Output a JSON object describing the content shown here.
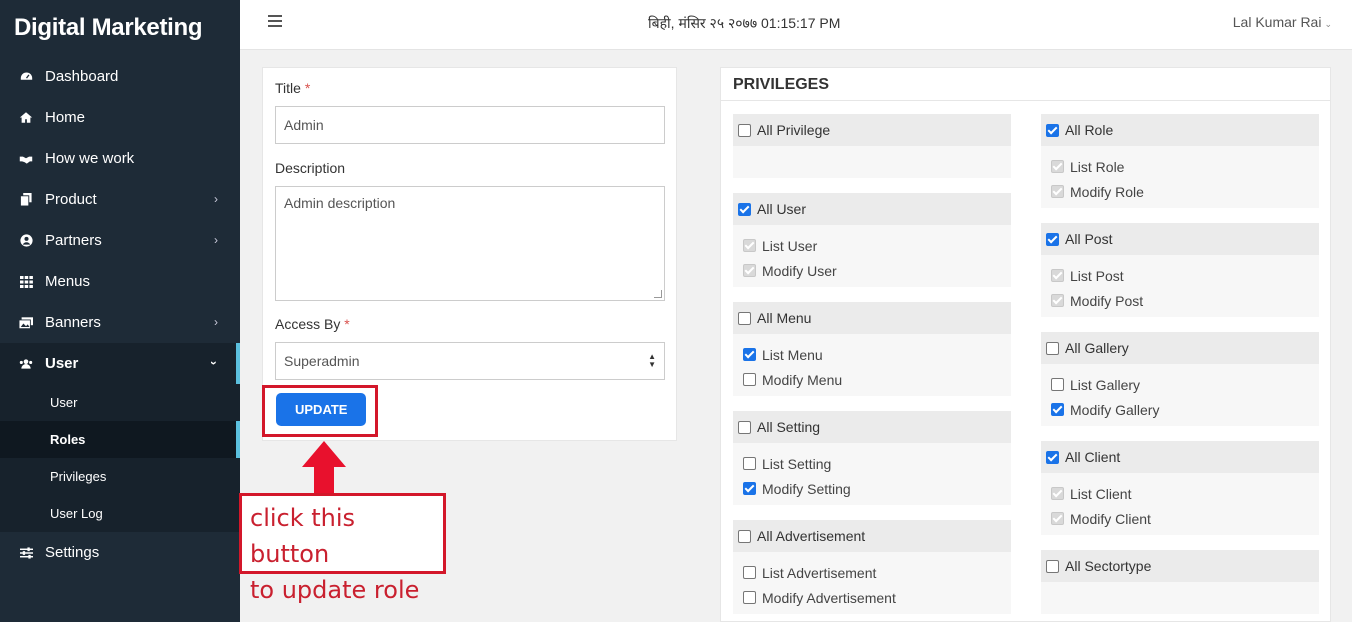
{
  "sidebar": {
    "brand": "Digital Marketing",
    "items": [
      {
        "label": "Dashboard",
        "icon": "dashboard-icon"
      },
      {
        "label": "Home",
        "icon": "home-icon"
      },
      {
        "label": "How we work",
        "icon": "handshake-icon"
      },
      {
        "label": "Product",
        "icon": "product-icon"
      },
      {
        "label": "Partners",
        "icon": "partners-icon"
      },
      {
        "label": "Menus",
        "icon": "grid-icon"
      },
      {
        "label": "Banners",
        "icon": "banners-icon"
      },
      {
        "label": "User",
        "icon": "users-icon"
      },
      {
        "label": "Settings",
        "icon": "sliders-icon"
      }
    ],
    "user_sub": [
      "User",
      "Roles",
      "Privileges",
      "User Log"
    ]
  },
  "header": {
    "datetime": "बिही, मंसिर २५ २०७७ 01:15:17 PM",
    "user": "Lal Kumar Rai"
  },
  "form": {
    "title_label": "Title",
    "title_value": "Admin",
    "description_label": "Description",
    "description_value": "Admin description",
    "access_label": "Access By",
    "access_value": "Superadmin",
    "required_mark": "*",
    "update_label": "UPDATE"
  },
  "annotation": {
    "line1": "click this button",
    "line2": "to update role"
  },
  "privileges": {
    "title": "PRIVILEGES",
    "left": [
      {
        "head": "All Privilege",
        "checked": false,
        "items": []
      },
      {
        "head": "All User",
        "checked": true,
        "items": [
          {
            "label": "List User",
            "state": "disabled"
          },
          {
            "label": "Modify User",
            "state": "disabled"
          }
        ]
      },
      {
        "head": "All Menu",
        "checked": false,
        "items": [
          {
            "label": "List Menu",
            "state": "checked"
          },
          {
            "label": "Modify Menu",
            "state": "unchecked"
          }
        ]
      },
      {
        "head": "All Setting",
        "checked": false,
        "items": [
          {
            "label": "List Setting",
            "state": "unchecked"
          },
          {
            "label": "Modify Setting",
            "state": "checked"
          }
        ]
      },
      {
        "head": "All Advertisement",
        "checked": false,
        "items": [
          {
            "label": "List Advertisement",
            "state": "unchecked"
          },
          {
            "label": "Modify Advertisement",
            "state": "unchecked"
          }
        ]
      }
    ],
    "right": [
      {
        "head": "All Role",
        "checked": true,
        "items": [
          {
            "label": "List Role",
            "state": "disabled"
          },
          {
            "label": "Modify Role",
            "state": "disabled"
          }
        ]
      },
      {
        "head": "All Post",
        "checked": true,
        "items": [
          {
            "label": "List Post",
            "state": "disabled"
          },
          {
            "label": "Modify Post",
            "state": "disabled"
          }
        ]
      },
      {
        "head": "All Gallery",
        "checked": false,
        "items": [
          {
            "label": "List Gallery",
            "state": "unchecked"
          },
          {
            "label": "Modify Gallery",
            "state": "checked"
          }
        ]
      },
      {
        "head": "All Client",
        "checked": true,
        "items": [
          {
            "label": "List Client",
            "state": "disabled"
          },
          {
            "label": "Modify Client",
            "state": "disabled"
          }
        ]
      },
      {
        "head": "All Sectortype",
        "checked": false,
        "items": []
      }
    ]
  },
  "colors": {
    "sidebar": "#1e2b37",
    "accent": "#1a73e8",
    "annotation": "#d3172a"
  }
}
